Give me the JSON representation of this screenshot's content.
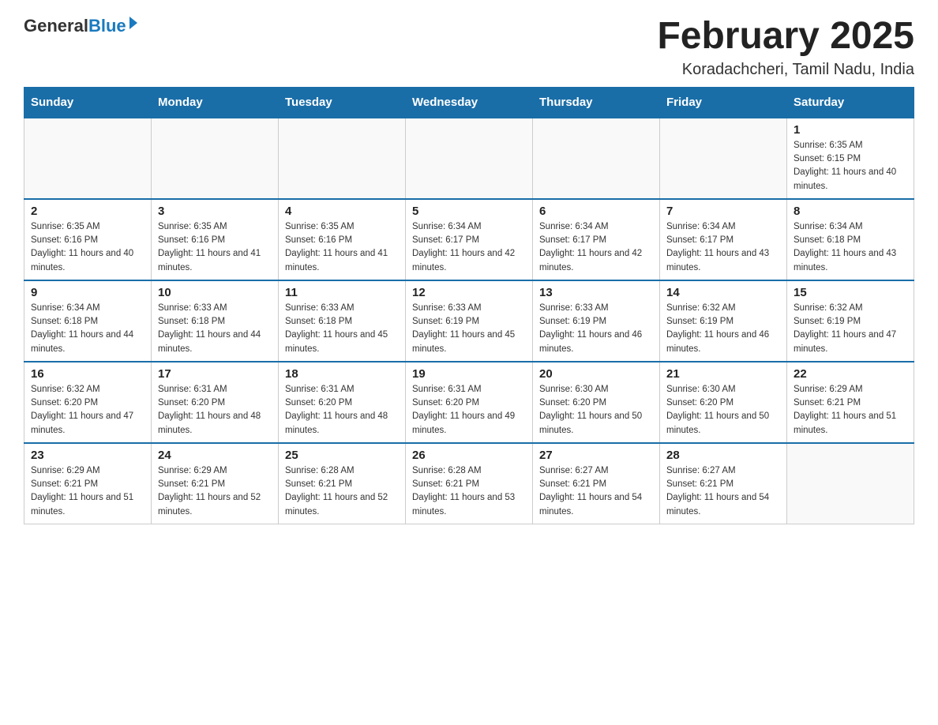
{
  "header": {
    "logo_general": "General",
    "logo_blue": "Blue",
    "month_year": "February 2025",
    "location": "Koradachcheri, Tamil Nadu, India"
  },
  "days_of_week": [
    "Sunday",
    "Monday",
    "Tuesday",
    "Wednesday",
    "Thursday",
    "Friday",
    "Saturday"
  ],
  "weeks": [
    [
      {
        "day": "",
        "sunrise": "",
        "sunset": "",
        "daylight": ""
      },
      {
        "day": "",
        "sunrise": "",
        "sunset": "",
        "daylight": ""
      },
      {
        "day": "",
        "sunrise": "",
        "sunset": "",
        "daylight": ""
      },
      {
        "day": "",
        "sunrise": "",
        "sunset": "",
        "daylight": ""
      },
      {
        "day": "",
        "sunrise": "",
        "sunset": "",
        "daylight": ""
      },
      {
        "day": "",
        "sunrise": "",
        "sunset": "",
        "daylight": ""
      },
      {
        "day": "1",
        "sunrise": "Sunrise: 6:35 AM",
        "sunset": "Sunset: 6:15 PM",
        "daylight": "Daylight: 11 hours and 40 minutes."
      }
    ],
    [
      {
        "day": "2",
        "sunrise": "Sunrise: 6:35 AM",
        "sunset": "Sunset: 6:16 PM",
        "daylight": "Daylight: 11 hours and 40 minutes."
      },
      {
        "day": "3",
        "sunrise": "Sunrise: 6:35 AM",
        "sunset": "Sunset: 6:16 PM",
        "daylight": "Daylight: 11 hours and 41 minutes."
      },
      {
        "day": "4",
        "sunrise": "Sunrise: 6:35 AM",
        "sunset": "Sunset: 6:16 PM",
        "daylight": "Daylight: 11 hours and 41 minutes."
      },
      {
        "day": "5",
        "sunrise": "Sunrise: 6:34 AM",
        "sunset": "Sunset: 6:17 PM",
        "daylight": "Daylight: 11 hours and 42 minutes."
      },
      {
        "day": "6",
        "sunrise": "Sunrise: 6:34 AM",
        "sunset": "Sunset: 6:17 PM",
        "daylight": "Daylight: 11 hours and 42 minutes."
      },
      {
        "day": "7",
        "sunrise": "Sunrise: 6:34 AM",
        "sunset": "Sunset: 6:17 PM",
        "daylight": "Daylight: 11 hours and 43 minutes."
      },
      {
        "day": "8",
        "sunrise": "Sunrise: 6:34 AM",
        "sunset": "Sunset: 6:18 PM",
        "daylight": "Daylight: 11 hours and 43 minutes."
      }
    ],
    [
      {
        "day": "9",
        "sunrise": "Sunrise: 6:34 AM",
        "sunset": "Sunset: 6:18 PM",
        "daylight": "Daylight: 11 hours and 44 minutes."
      },
      {
        "day": "10",
        "sunrise": "Sunrise: 6:33 AM",
        "sunset": "Sunset: 6:18 PM",
        "daylight": "Daylight: 11 hours and 44 minutes."
      },
      {
        "day": "11",
        "sunrise": "Sunrise: 6:33 AM",
        "sunset": "Sunset: 6:18 PM",
        "daylight": "Daylight: 11 hours and 45 minutes."
      },
      {
        "day": "12",
        "sunrise": "Sunrise: 6:33 AM",
        "sunset": "Sunset: 6:19 PM",
        "daylight": "Daylight: 11 hours and 45 minutes."
      },
      {
        "day": "13",
        "sunrise": "Sunrise: 6:33 AM",
        "sunset": "Sunset: 6:19 PM",
        "daylight": "Daylight: 11 hours and 46 minutes."
      },
      {
        "day": "14",
        "sunrise": "Sunrise: 6:32 AM",
        "sunset": "Sunset: 6:19 PM",
        "daylight": "Daylight: 11 hours and 46 minutes."
      },
      {
        "day": "15",
        "sunrise": "Sunrise: 6:32 AM",
        "sunset": "Sunset: 6:19 PM",
        "daylight": "Daylight: 11 hours and 47 minutes."
      }
    ],
    [
      {
        "day": "16",
        "sunrise": "Sunrise: 6:32 AM",
        "sunset": "Sunset: 6:20 PM",
        "daylight": "Daylight: 11 hours and 47 minutes."
      },
      {
        "day": "17",
        "sunrise": "Sunrise: 6:31 AM",
        "sunset": "Sunset: 6:20 PM",
        "daylight": "Daylight: 11 hours and 48 minutes."
      },
      {
        "day": "18",
        "sunrise": "Sunrise: 6:31 AM",
        "sunset": "Sunset: 6:20 PM",
        "daylight": "Daylight: 11 hours and 48 minutes."
      },
      {
        "day": "19",
        "sunrise": "Sunrise: 6:31 AM",
        "sunset": "Sunset: 6:20 PM",
        "daylight": "Daylight: 11 hours and 49 minutes."
      },
      {
        "day": "20",
        "sunrise": "Sunrise: 6:30 AM",
        "sunset": "Sunset: 6:20 PM",
        "daylight": "Daylight: 11 hours and 50 minutes."
      },
      {
        "day": "21",
        "sunrise": "Sunrise: 6:30 AM",
        "sunset": "Sunset: 6:20 PM",
        "daylight": "Daylight: 11 hours and 50 minutes."
      },
      {
        "day": "22",
        "sunrise": "Sunrise: 6:29 AM",
        "sunset": "Sunset: 6:21 PM",
        "daylight": "Daylight: 11 hours and 51 minutes."
      }
    ],
    [
      {
        "day": "23",
        "sunrise": "Sunrise: 6:29 AM",
        "sunset": "Sunset: 6:21 PM",
        "daylight": "Daylight: 11 hours and 51 minutes."
      },
      {
        "day": "24",
        "sunrise": "Sunrise: 6:29 AM",
        "sunset": "Sunset: 6:21 PM",
        "daylight": "Daylight: 11 hours and 52 minutes."
      },
      {
        "day": "25",
        "sunrise": "Sunrise: 6:28 AM",
        "sunset": "Sunset: 6:21 PM",
        "daylight": "Daylight: 11 hours and 52 minutes."
      },
      {
        "day": "26",
        "sunrise": "Sunrise: 6:28 AM",
        "sunset": "Sunset: 6:21 PM",
        "daylight": "Daylight: 11 hours and 53 minutes."
      },
      {
        "day": "27",
        "sunrise": "Sunrise: 6:27 AM",
        "sunset": "Sunset: 6:21 PM",
        "daylight": "Daylight: 11 hours and 54 minutes."
      },
      {
        "day": "28",
        "sunrise": "Sunrise: 6:27 AM",
        "sunset": "Sunset: 6:21 PM",
        "daylight": "Daylight: 11 hours and 54 minutes."
      },
      {
        "day": "",
        "sunrise": "",
        "sunset": "",
        "daylight": ""
      }
    ]
  ]
}
